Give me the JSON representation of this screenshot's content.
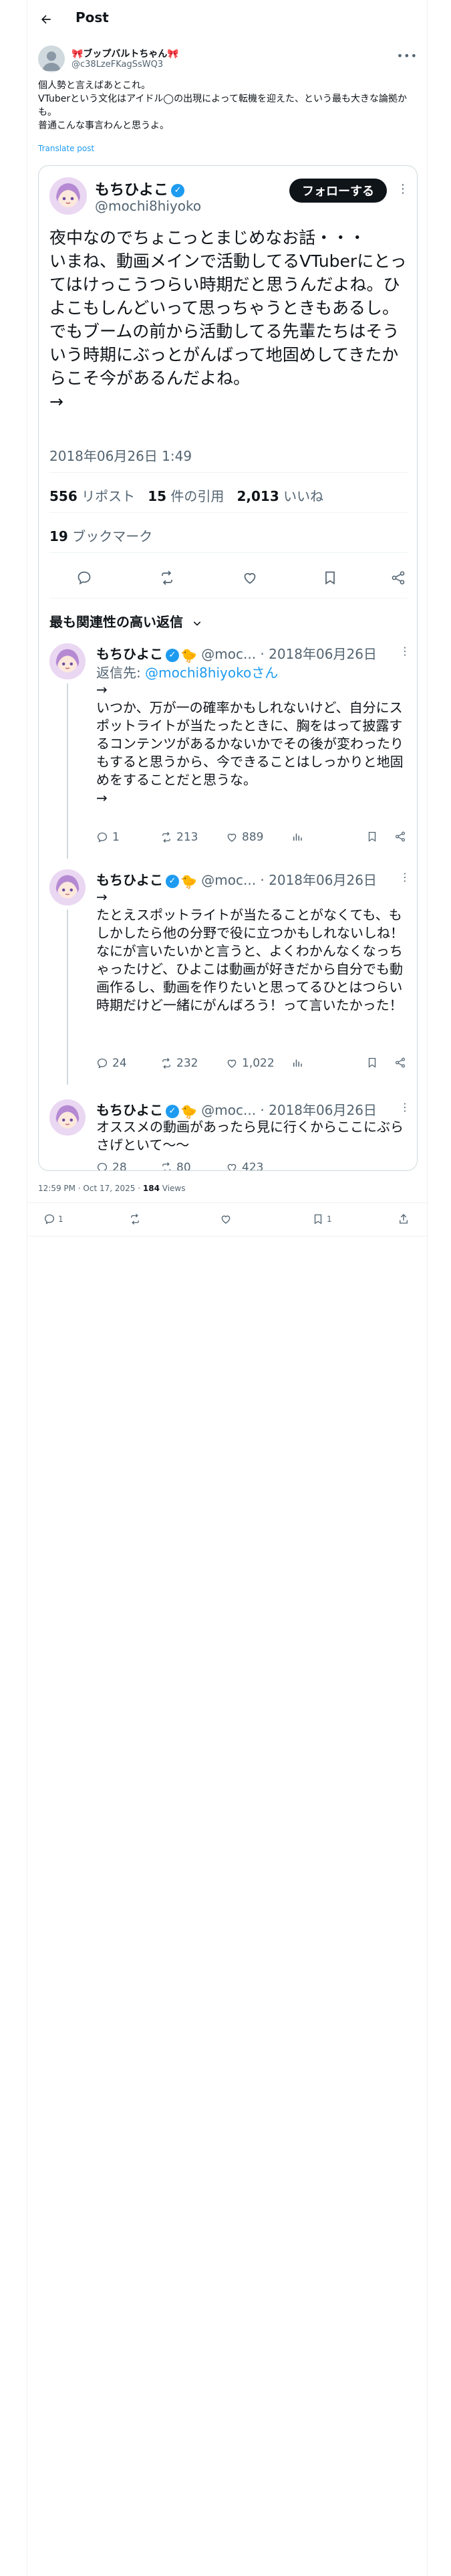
{
  "header": {
    "title": "Post"
  },
  "post": {
    "author_name": "🎀ブップバルトちゃん🎀",
    "author_handle": "@c38LzeFKagSsWQ3",
    "text": "個人勢と言えばあとこれ。\nVTuberという文化はアイドル◯の出現によって転機を迎えた、という最も大きな論拠かも。\n普通こんな事言わんと思うよ。",
    "translate_label": "Translate post",
    "timestamp": "12:59 PM · Oct 17, 2025",
    "views_count": "184",
    "views_label": " Views",
    "reply_count": "1",
    "bookmark_count": "1"
  },
  "quote": {
    "name": "もちひよこ",
    "handle": "@mochi8hiyoko",
    "follow_label": "フォローする",
    "text": "夜中なのでちょこっとまじめなお話・・・\nいまね、動画メインで活動してるVTuberにとってはけっこうつらい時期だと思うんだよね。ひよこもしんどいって思っちゃうときもあるし。\nでもブームの前から活動してる先輩たちはそういう時期にぶっとがんばって地固めしてきたからこそ今があるんだよね。\n→",
    "date": "2018年06月26日 1:49",
    "retweets": "556",
    "retweets_label": " リポスト",
    "quotes": "15",
    "quotes_label": " 件の引用",
    "likes": "2,013",
    "likes_label": " いいね",
    "bookmarks": "19",
    "bookmarks_label": " ブックマーク",
    "sort_label": "最も関連性の高い返信"
  },
  "replies": [
    {
      "name": "もちひよこ",
      "meta": " @moc... · 2018年06月26日",
      "reply_to_prefix": "返信先: ",
      "reply_to_handle": "@mochi8hiyokoさん",
      "text": "→\nいつか、万が一の確率かもしれないけど、自分にスポットライトが当たったときに、胸をはって披露するコンテンツがあるかないかでその後が変わったりもすると思うから、今できることはしっかりと地固めをすることだと思うな。\n→",
      "replies": "1",
      "retweets": "213",
      "likes": "889"
    },
    {
      "name": "もちひよこ",
      "meta": " @moc... · 2018年06月26日",
      "text": "→\nたとえスポットライトが当たることがなくても、もしかしたら他の分野で役に立つかもしれないしね！\nなにが言いたいかと言うと、よくわかんなくなっちゃったけど、ひよこは動画が好きだから自分でも動画作るし、動画を作りたいと思ってるひとはつらい時期だけど一緒にがんばろう！って言いたかった！",
      "replies": "24",
      "retweets": "232",
      "likes": "1,022"
    },
    {
      "name": "もちひよこ",
      "meta": " @moc... · 2018年06月26日",
      "text": "オススメの動画があったら見に行くからここにぶらさげといて〜〜",
      "replies": "28",
      "retweets": "80",
      "likes": "423"
    }
  ],
  "icons": [
    "back-arrow-icon",
    "more-icon",
    "verified-badge-icon",
    "chick-icon",
    "reply-icon",
    "retweet-icon",
    "like-icon",
    "bookmark-icon",
    "share-icon",
    "views-icon",
    "chevron-down-icon"
  ],
  "colors": {
    "accent": "#1d9bf0",
    "text": "#0f1419",
    "muted": "#536471",
    "border": "#cfd9de",
    "follow_bg": "#0f1419"
  }
}
